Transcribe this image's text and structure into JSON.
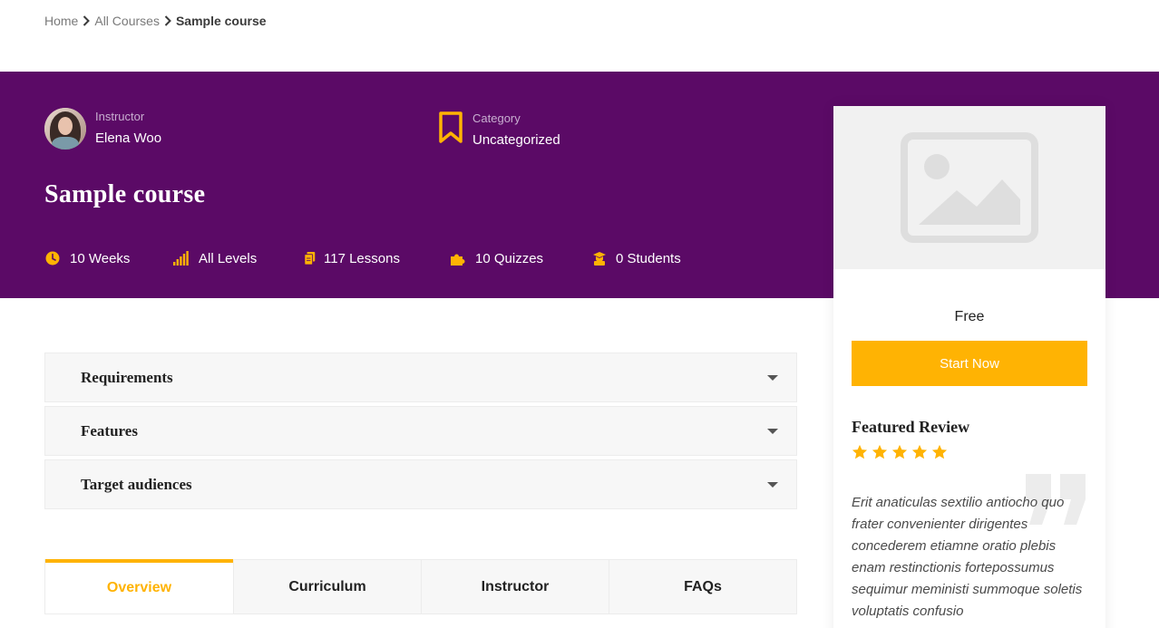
{
  "breadcrumb": {
    "items": [
      "Home",
      "All Courses"
    ],
    "current": "Sample course"
  },
  "hero": {
    "instructor_label": "Instructor",
    "instructor_name": "Elena Woo",
    "category_label": "Category",
    "category_value": "Uncategorized",
    "title": "Sample course",
    "stats": {
      "duration": "10 Weeks",
      "level": "All Levels",
      "lessons": "117 Lessons",
      "quizzes": "10 Quizzes",
      "students": "0 Students"
    }
  },
  "icons": {
    "clock": "clock-icon",
    "level": "signal-bars-icon",
    "lessons": "files-icon",
    "quizzes": "puzzle-icon",
    "students": "graduate-icon",
    "category": "bookmark-icon",
    "thumbnail": "image-placeholder-icon",
    "star": "star-icon",
    "quote": "quote-icon",
    "caret": "caret-down-icon",
    "chevron": "chevron-right-icon"
  },
  "colors": {
    "hero_bg": "#5b0a66",
    "accent": "#ffb303",
    "white": "#ffffff"
  },
  "sidebar": {
    "price": "Free",
    "start_button": "Start Now",
    "featured_review_title": "Featured Review",
    "rating": 5,
    "rating_max": 5,
    "review_text": "Erit anaticulas sextilio antiocho quo frater convenienter dirigentes concederem etiamne oratio plebis enam restinctionis fortepossumus sequimur meministi summoque soletis voluptatis confusio"
  },
  "accordions": [
    {
      "title": "Requirements"
    },
    {
      "title": "Features"
    },
    {
      "title": "Target audiences"
    }
  ],
  "tabs": [
    {
      "label": "Overview",
      "active": true
    },
    {
      "label": "Curriculum",
      "active": false
    },
    {
      "label": "Instructor",
      "active": false
    },
    {
      "label": "FAQs",
      "active": false
    }
  ]
}
